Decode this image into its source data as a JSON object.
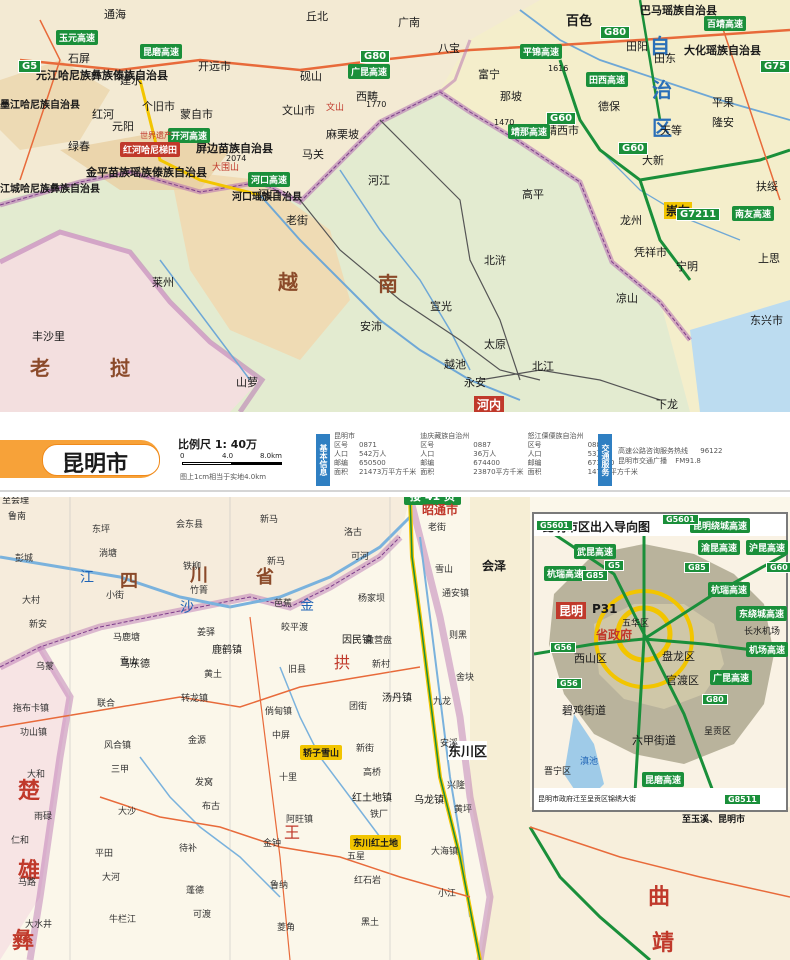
{
  "top_map": {
    "country_labels": [
      "越",
      "南",
      "老",
      "挝"
    ],
    "province_labels": [
      "自",
      "治",
      "区"
    ],
    "cities": [
      {
        "name": "红河",
        "size": "n"
      },
      {
        "name": "元阳",
        "size": "n"
      },
      {
        "name": "绿春",
        "size": "n"
      },
      {
        "name": "石屏",
        "size": "n"
      },
      {
        "name": "建水",
        "size": "n"
      },
      {
        "name": "个旧市",
        "size": "n"
      },
      {
        "name": "蒙自市",
        "size": "n"
      },
      {
        "name": "开远市",
        "size": "n"
      },
      {
        "name": "砚山",
        "size": "n"
      },
      {
        "name": "文山市",
        "size": "n"
      },
      {
        "name": "西畴",
        "size": "n"
      },
      {
        "name": "麻栗坡",
        "size": "n"
      },
      {
        "name": "马关",
        "size": "n"
      },
      {
        "name": "河口",
        "size": "n"
      },
      {
        "name": "老街",
        "size": "n"
      },
      {
        "name": "河江",
        "size": "n"
      },
      {
        "name": "高平",
        "size": "n"
      },
      {
        "name": "北浒",
        "size": "n"
      },
      {
        "name": "宣光",
        "size": "n"
      },
      {
        "name": "安沛",
        "size": "n"
      },
      {
        "name": "太原",
        "size": "n"
      },
      {
        "name": "越池",
        "size": "n"
      },
      {
        "name": "北江",
        "size": "n"
      },
      {
        "name": "永安",
        "size": "n"
      },
      {
        "name": "河内",
        "size": "n"
      },
      {
        "name": "下龙",
        "size": "n"
      },
      {
        "name": "凉山",
        "size": "n"
      },
      {
        "name": "宁明",
        "size": "n"
      },
      {
        "name": "凭祥市",
        "size": "n"
      },
      {
        "name": "龙州",
        "size": "n"
      },
      {
        "name": "大新",
        "size": "n"
      },
      {
        "name": "天等",
        "size": "n"
      },
      {
        "name": "靖西市",
        "size": "n"
      },
      {
        "name": "那坡",
        "size": "n"
      },
      {
        "name": "德保",
        "size": "n"
      },
      {
        "name": "田阳",
        "size": "n"
      },
      {
        "name": "田东",
        "size": "n"
      },
      {
        "name": "平果",
        "size": "n"
      },
      {
        "name": "隆安",
        "size": "n"
      },
      {
        "name": "扶绥",
        "size": "n"
      },
      {
        "name": "崇左",
        "size": "n"
      },
      {
        "name": "上思",
        "size": "n"
      },
      {
        "name": "东兴市",
        "size": "n"
      },
      {
        "name": "富宁",
        "size": "n"
      },
      {
        "name": "广南",
        "size": "n"
      },
      {
        "name": "丘北",
        "size": "n"
      },
      {
        "name": "莱州",
        "size": "n"
      },
      {
        "name": "丰沙里",
        "size": "n"
      },
      {
        "name": "山萝",
        "size": "n"
      },
      {
        "name": "百色",
        "size": "n"
      },
      {
        "name": "八宝",
        "size": "n"
      },
      {
        "name": "通海",
        "size": "n"
      }
    ],
    "admin_labels": [
      "元江哈尼族彝族傣族自治县",
      "屏边苗族自治县",
      "金平苗族瑶族傣族自治县",
      "河口瑶族自治县",
      "巴马瑶族自治县",
      "大化瑶族自治县",
      "江城哈尼族彝族自治县",
      "墨江哈尼族自治县"
    ],
    "highways": [
      "G80",
      "G5",
      "G60",
      "G80",
      "G75",
      "G7211",
      "G60"
    ],
    "highway_names": [
      "广昆高速",
      "昆磨高速",
      "开河高速",
      "玉元高速",
      "平锦高速",
      "南友高速",
      "靖那高速",
      "百靖高速",
      "河口高速",
      "田西高速"
    ],
    "peaks": [
      "1770",
      "1616",
      "1470",
      "2074"
    ],
    "scenic": [
      "红河哈尼梯田",
      "大围山",
      "文山",
      "世界遗产"
    ]
  },
  "header": {
    "city_title": "昆明市",
    "scale_label": "比例尺 1: 40万",
    "scale_ticks": [
      "0",
      "4.0",
      "8.0km"
    ],
    "scale_note": "图上1cm相当于实地4.0km",
    "basic_info_tag": "基本信息",
    "info_table": [
      [
        "昆明市",
        "",
        "迪庆藏族自治州",
        "",
        "怒江傈僳族自治州",
        ""
      ],
      [
        "区号",
        "0871",
        "区号",
        "0887",
        "区号",
        "0886"
      ],
      [
        "人口",
        "542万人",
        "人口",
        "36万人",
        "人口",
        "53万人"
      ],
      [
        "邮编",
        "650500",
        "邮编",
        "674400",
        "邮编",
        "673000"
      ],
      [
        "面积",
        "21473万平方千米",
        "面积",
        "23870平方千米",
        "面积",
        "14703平方千米"
      ]
    ],
    "traffic_tag": "交通服务",
    "traffic_info": [
      [
        "高速公路咨询服务热线",
        "96122"
      ],
      [
        "昆明市交通广播",
        "FM91.8"
      ]
    ]
  },
  "bottom_map": {
    "connect_label": "接 41 页",
    "top_note": "至会理",
    "province_labels": [
      "四",
      "川",
      "省"
    ],
    "city_labels": [
      "楚",
      "雄",
      "彝",
      "曲",
      "靖"
    ],
    "district_labels": [
      "昭通市",
      "会泽",
      "东川区",
      "汤丹镇",
      "乌东德",
      "鹿鹤镇",
      "因民镇",
      "红土地镇",
      "乌龙镇"
    ],
    "towns": [
      "鲁南",
      "东坪",
      "会东县",
      "新马",
      "洛古",
      "老街",
      "彭城",
      "淌塘",
      "铁柳",
      "新马",
      "可河",
      "雪山",
      "大村",
      "小街",
      "竹箐",
      "芭蕉",
      "杨家坝",
      "通安镇",
      "新安",
      "马鹿塘",
      "姜驿",
      "皎平渡",
      "撒营盘",
      "则黑",
      "乌蒙",
      "雪山",
      "黄土",
      "旧县",
      "新村",
      "舍块",
      "拖布卡镇",
      "联合",
      "转龙镇",
      "倘甸镇",
      "团街",
      "九龙",
      "功山镇",
      "风合镇",
      "金源",
      "中屏",
      "新街",
      "安溪",
      "大和",
      "三甲",
      "发窝",
      "十里",
      "高桥",
      "兴隆",
      "雨碌",
      "大沙",
      "布古",
      "阿旺镇",
      "铁厂",
      "黄坪",
      "仁和",
      "平田",
      "待补",
      "金钟",
      "五星",
      "大海镇",
      "马路",
      "大河",
      "蓬德",
      "鲁纳",
      "红石岩",
      "小江",
      "大水井",
      "牛栏江",
      "可渡",
      "菱角",
      "黑土"
    ],
    "scenic": [
      "轿子雪山",
      "东川红土地"
    ],
    "rivers": [
      "金",
      "沙",
      "江",
      "拱",
      "王"
    ]
  },
  "inset": {
    "title": "昆明市区出入导向图",
    "center_label": "昆明",
    "center_ref": "P31",
    "government": "省政府",
    "districts": [
      "西山区",
      "盘龙区",
      "官渡区",
      "五华区",
      "呈贡区",
      "晋宁区"
    ],
    "places": [
      "碧鸡街道",
      "六甲街道",
      "滇池",
      "长水机场"
    ],
    "highways_right": [
      "昆明绕城高速",
      "渝昆高速",
      "沪昆高速",
      "杭瑞高速",
      "东绕城高速",
      "机场高速",
      "广昆高速",
      "昆磨高速"
    ],
    "highways_left": [
      "武昆高速",
      "杭瑞高速",
      "G5601",
      "G56",
      "G85"
    ],
    "highway_codes": [
      "G5601",
      "G5",
      "G56",
      "G85",
      "G60",
      "G80",
      "G8511",
      "G5601"
    ],
    "note": "昆明市政府迁至呈贡区锦绣大街",
    "footer": "至玉溪、昆明市"
  },
  "colors": {
    "vietnam_fill": "#e7ecd2",
    "china_hill": "#f0d8b0",
    "laos_fill": "#f3dede",
    "border_purple": "#b46bb0",
    "water": "#9fcbe8",
    "highway_green": "#1a8f3a",
    "road_yellow": "#f2c500",
    "title_orange": "#f08a1a"
  }
}
